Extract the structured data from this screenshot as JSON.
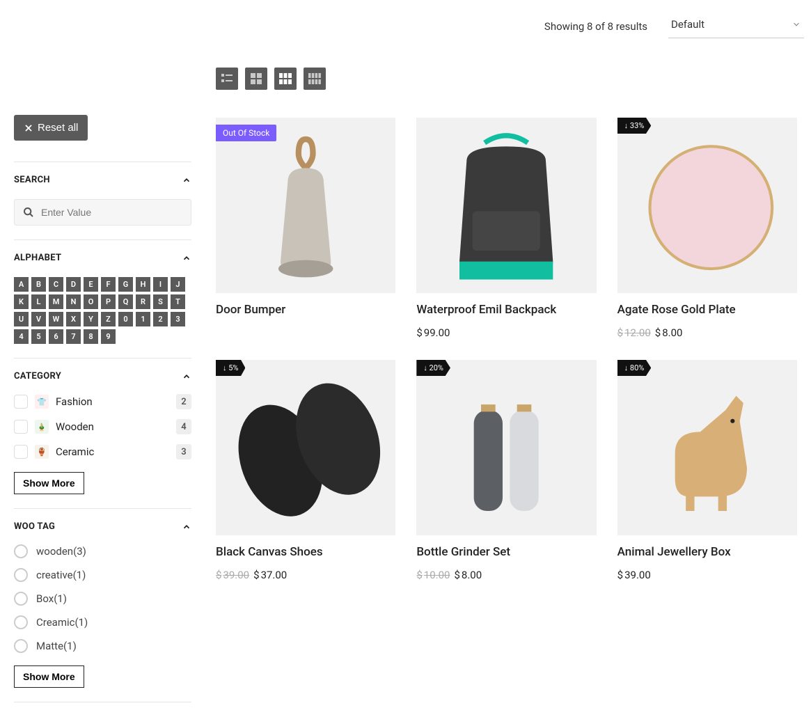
{
  "topbar": {
    "results_text": "Showing 8 of 8 results",
    "sort_label": "Default"
  },
  "reset_label": "Reset all",
  "filters": {
    "search": {
      "title": "SEARCH",
      "placeholder": "Enter Value"
    },
    "alphabet": {
      "title": "ALPHABET",
      "chars": [
        "A",
        "B",
        "C",
        "D",
        "E",
        "F",
        "G",
        "H",
        "I",
        "J",
        "K",
        "L",
        "M",
        "N",
        "O",
        "P",
        "Q",
        "R",
        "S",
        "T",
        "U",
        "V",
        "W",
        "X",
        "Y",
        "Z",
        "0",
        "1",
        "2",
        "3",
        "4",
        "5",
        "6",
        "7",
        "8",
        "9"
      ]
    },
    "category": {
      "title": "CATEGORY",
      "items": [
        {
          "label": "Fashion",
          "count": "2"
        },
        {
          "label": "Wooden",
          "count": "4"
        },
        {
          "label": "Ceramic",
          "count": "3"
        }
      ],
      "show_more": "Show More"
    },
    "tags": {
      "title": "WOO TAG",
      "items": [
        {
          "label": "wooden",
          "count": "3"
        },
        {
          "label": "creative",
          "count": "1"
        },
        {
          "label": "Box",
          "count": "1"
        },
        {
          "label": "Creamic",
          "count": "1"
        },
        {
          "label": "Matte",
          "count": "1"
        }
      ],
      "show_more": "Show More"
    }
  },
  "products": [
    {
      "title": "Door Bumper",
      "badge_type": "oos",
      "badge_text": "Out Of Stock",
      "price_old": null,
      "price": null
    },
    {
      "title": "Waterproof Emil Backpack",
      "badge_type": null,
      "badge_text": null,
      "price_old": null,
      "price": "99.00"
    },
    {
      "title": "Agate Rose Gold Plate",
      "badge_type": "disc",
      "badge_text": "↓ 33%",
      "price_old": "12.00",
      "price": "8.00"
    },
    {
      "title": "Black Canvas Shoes",
      "badge_type": "disc",
      "badge_text": "↓ 5%",
      "price_old": "39.00",
      "price": "37.00"
    },
    {
      "title": "Bottle Grinder Set",
      "badge_type": "disc",
      "badge_text": "↓ 20%",
      "price_old": "10.00",
      "price": "8.00"
    },
    {
      "title": "Animal Jewellery Box",
      "badge_type": "disc",
      "badge_text": "↓ 80%",
      "price_old": null,
      "price": "39.00"
    }
  ],
  "currency": "$"
}
